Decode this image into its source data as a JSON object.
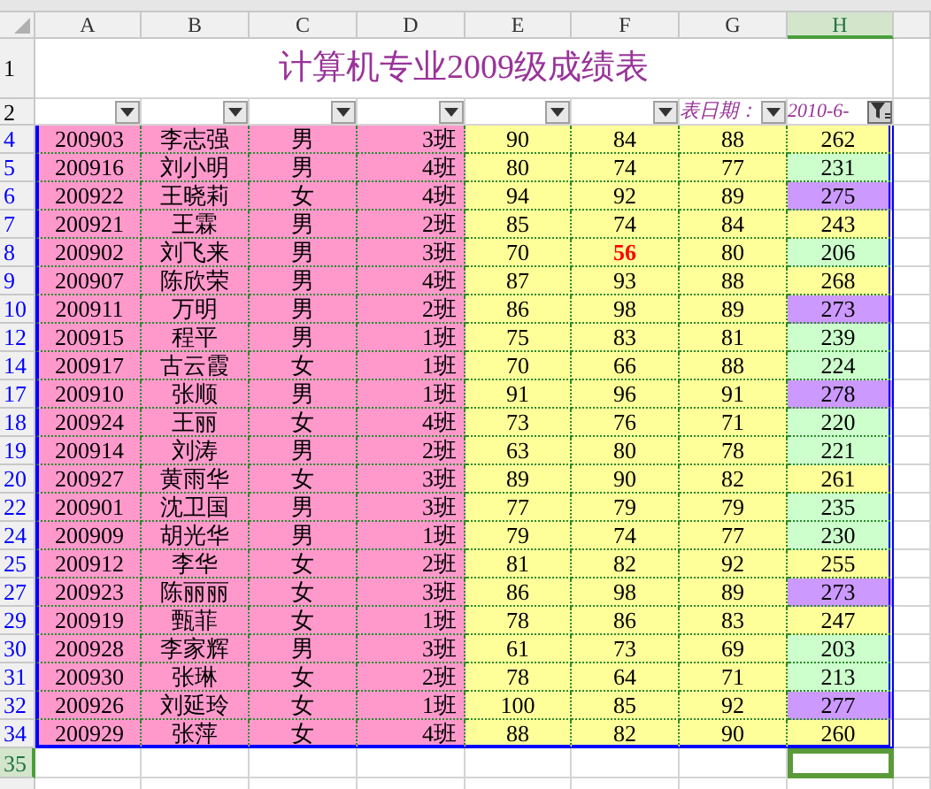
{
  "columns": [
    {
      "label": "A",
      "selected": false
    },
    {
      "label": "B",
      "selected": false
    },
    {
      "label": "C",
      "selected": false
    },
    {
      "label": "D",
      "selected": false
    },
    {
      "label": "E",
      "selected": false
    },
    {
      "label": "F",
      "selected": false
    },
    {
      "label": "G",
      "selected": false
    },
    {
      "label": "H",
      "selected": true
    }
  ],
  "title_row": {
    "number": "1",
    "title": "计算机专业2009级成绩表"
  },
  "filter_row": {
    "number": "2",
    "filters": [
      {
        "active": false
      },
      {
        "active": false
      },
      {
        "active": false
      },
      {
        "active": false
      },
      {
        "active": false
      },
      {
        "active": false
      },
      {
        "active": false
      },
      {
        "active": true
      }
    ],
    "date_label": "表日期：",
    "date_value": "2010-6-"
  },
  "rows": [
    {
      "number": "4",
      "id": "200903",
      "name": "李志强",
      "gender": "男",
      "class": "3班",
      "scores": [
        "90",
        "84",
        "88"
      ],
      "alerts": [
        false,
        false,
        false
      ],
      "total": "262",
      "color": "#ffff99"
    },
    {
      "number": "5",
      "id": "200916",
      "name": "刘小明",
      "gender": "男",
      "class": "4班",
      "scores": [
        "80",
        "74",
        "77"
      ],
      "alerts": [
        false,
        false,
        false
      ],
      "total": "231",
      "color": "#ccffcc"
    },
    {
      "number": "6",
      "id": "200922",
      "name": "王晓莉",
      "gender": "女",
      "class": "4班",
      "scores": [
        "94",
        "92",
        "89"
      ],
      "alerts": [
        false,
        false,
        false
      ],
      "total": "275",
      "color": "#cc99ff"
    },
    {
      "number": "7",
      "id": "200921",
      "name": "王霖",
      "gender": "男",
      "class": "2班",
      "scores": [
        "85",
        "74",
        "84"
      ],
      "alerts": [
        false,
        false,
        false
      ],
      "total": "243",
      "color": "#ffff99"
    },
    {
      "number": "8",
      "id": "200902",
      "name": "刘飞来",
      "gender": "男",
      "class": "3班",
      "scores": [
        "70",
        "56",
        "80"
      ],
      "alerts": [
        false,
        true,
        false
      ],
      "total": "206",
      "color": "#ccffcc"
    },
    {
      "number": "9",
      "id": "200907",
      "name": "陈欣荣",
      "gender": "男",
      "class": "4班",
      "scores": [
        "87",
        "93",
        "88"
      ],
      "alerts": [
        false,
        false,
        false
      ],
      "total": "268",
      "color": "#ffff99"
    },
    {
      "number": "10",
      "id": "200911",
      "name": "万明",
      "gender": "男",
      "class": "2班",
      "scores": [
        "86",
        "98",
        "89"
      ],
      "alerts": [
        false,
        false,
        false
      ],
      "total": "273",
      "color": "#cc99ff"
    },
    {
      "number": "12",
      "id": "200915",
      "name": "程平",
      "gender": "男",
      "class": "1班",
      "scores": [
        "75",
        "83",
        "81"
      ],
      "alerts": [
        false,
        false,
        false
      ],
      "total": "239",
      "color": "#ccffcc"
    },
    {
      "number": "14",
      "id": "200917",
      "name": "古云霞",
      "gender": "女",
      "class": "1班",
      "scores": [
        "70",
        "66",
        "88"
      ],
      "alerts": [
        false,
        false,
        false
      ],
      "total": "224",
      "color": "#ccffcc"
    },
    {
      "number": "17",
      "id": "200910",
      "name": "张顺",
      "gender": "男",
      "class": "1班",
      "scores": [
        "91",
        "96",
        "91"
      ],
      "alerts": [
        false,
        false,
        false
      ],
      "total": "278",
      "color": "#cc99ff"
    },
    {
      "number": "18",
      "id": "200924",
      "name": "王丽",
      "gender": "女",
      "class": "4班",
      "scores": [
        "73",
        "76",
        "71"
      ],
      "alerts": [
        false,
        false,
        false
      ],
      "total": "220",
      "color": "#ccffcc"
    },
    {
      "number": "19",
      "id": "200914",
      "name": "刘涛",
      "gender": "男",
      "class": "2班",
      "scores": [
        "63",
        "80",
        "78"
      ],
      "alerts": [
        false,
        false,
        false
      ],
      "total": "221",
      "color": "#ccffcc"
    },
    {
      "number": "20",
      "id": "200927",
      "name": "黄雨华",
      "gender": "女",
      "class": "3班",
      "scores": [
        "89",
        "90",
        "82"
      ],
      "alerts": [
        false,
        false,
        false
      ],
      "total": "261",
      "color": "#ffff99"
    },
    {
      "number": "22",
      "id": "200901",
      "name": "沈卫国",
      "gender": "男",
      "class": "3班",
      "scores": [
        "77",
        "79",
        "79"
      ],
      "alerts": [
        false,
        false,
        false
      ],
      "total": "235",
      "color": "#ccffcc"
    },
    {
      "number": "24",
      "id": "200909",
      "name": "胡光华",
      "gender": "男",
      "class": "1班",
      "scores": [
        "79",
        "74",
        "77"
      ],
      "alerts": [
        false,
        false,
        false
      ],
      "total": "230",
      "color": "#ccffcc"
    },
    {
      "number": "25",
      "id": "200912",
      "name": "李华",
      "gender": "女",
      "class": "2班",
      "scores": [
        "81",
        "82",
        "92"
      ],
      "alerts": [
        false,
        false,
        false
      ],
      "total": "255",
      "color": "#ffff99"
    },
    {
      "number": "27",
      "id": "200923",
      "name": "陈丽丽",
      "gender": "女",
      "class": "3班",
      "scores": [
        "86",
        "98",
        "89"
      ],
      "alerts": [
        false,
        false,
        false
      ],
      "total": "273",
      "color": "#cc99ff"
    },
    {
      "number": "29",
      "id": "200919",
      "name": "甄菲",
      "gender": "女",
      "class": "1班",
      "scores": [
        "78",
        "86",
        "83"
      ],
      "alerts": [
        false,
        false,
        false
      ],
      "total": "247",
      "color": "#ffff99"
    },
    {
      "number": "30",
      "id": "200928",
      "name": "李家辉",
      "gender": "男",
      "class": "3班",
      "scores": [
        "61",
        "73",
        "69"
      ],
      "alerts": [
        false,
        false,
        false
      ],
      "total": "203",
      "color": "#ccffcc"
    },
    {
      "number": "31",
      "id": "200930",
      "name": "张琳",
      "gender": "女",
      "class": "2班",
      "scores": [
        "78",
        "64",
        "71"
      ],
      "alerts": [
        false,
        false,
        false
      ],
      "total": "213",
      "color": "#ccffcc"
    },
    {
      "number": "32",
      "id": "200926",
      "name": "刘延玲",
      "gender": "女",
      "class": "1班",
      "scores": [
        "100",
        "85",
        "92"
      ],
      "alerts": [
        false,
        false,
        false
      ],
      "total": "277",
      "color": "#cc99ff"
    },
    {
      "number": "34",
      "id": "200929",
      "name": "张萍",
      "gender": "女",
      "class": "4班",
      "scores": [
        "88",
        "82",
        "90"
      ],
      "alerts": [
        false,
        false,
        false
      ],
      "total": "260",
      "color": "#ffff99"
    }
  ],
  "empty_row": {
    "number": "35",
    "selected": true
  }
}
